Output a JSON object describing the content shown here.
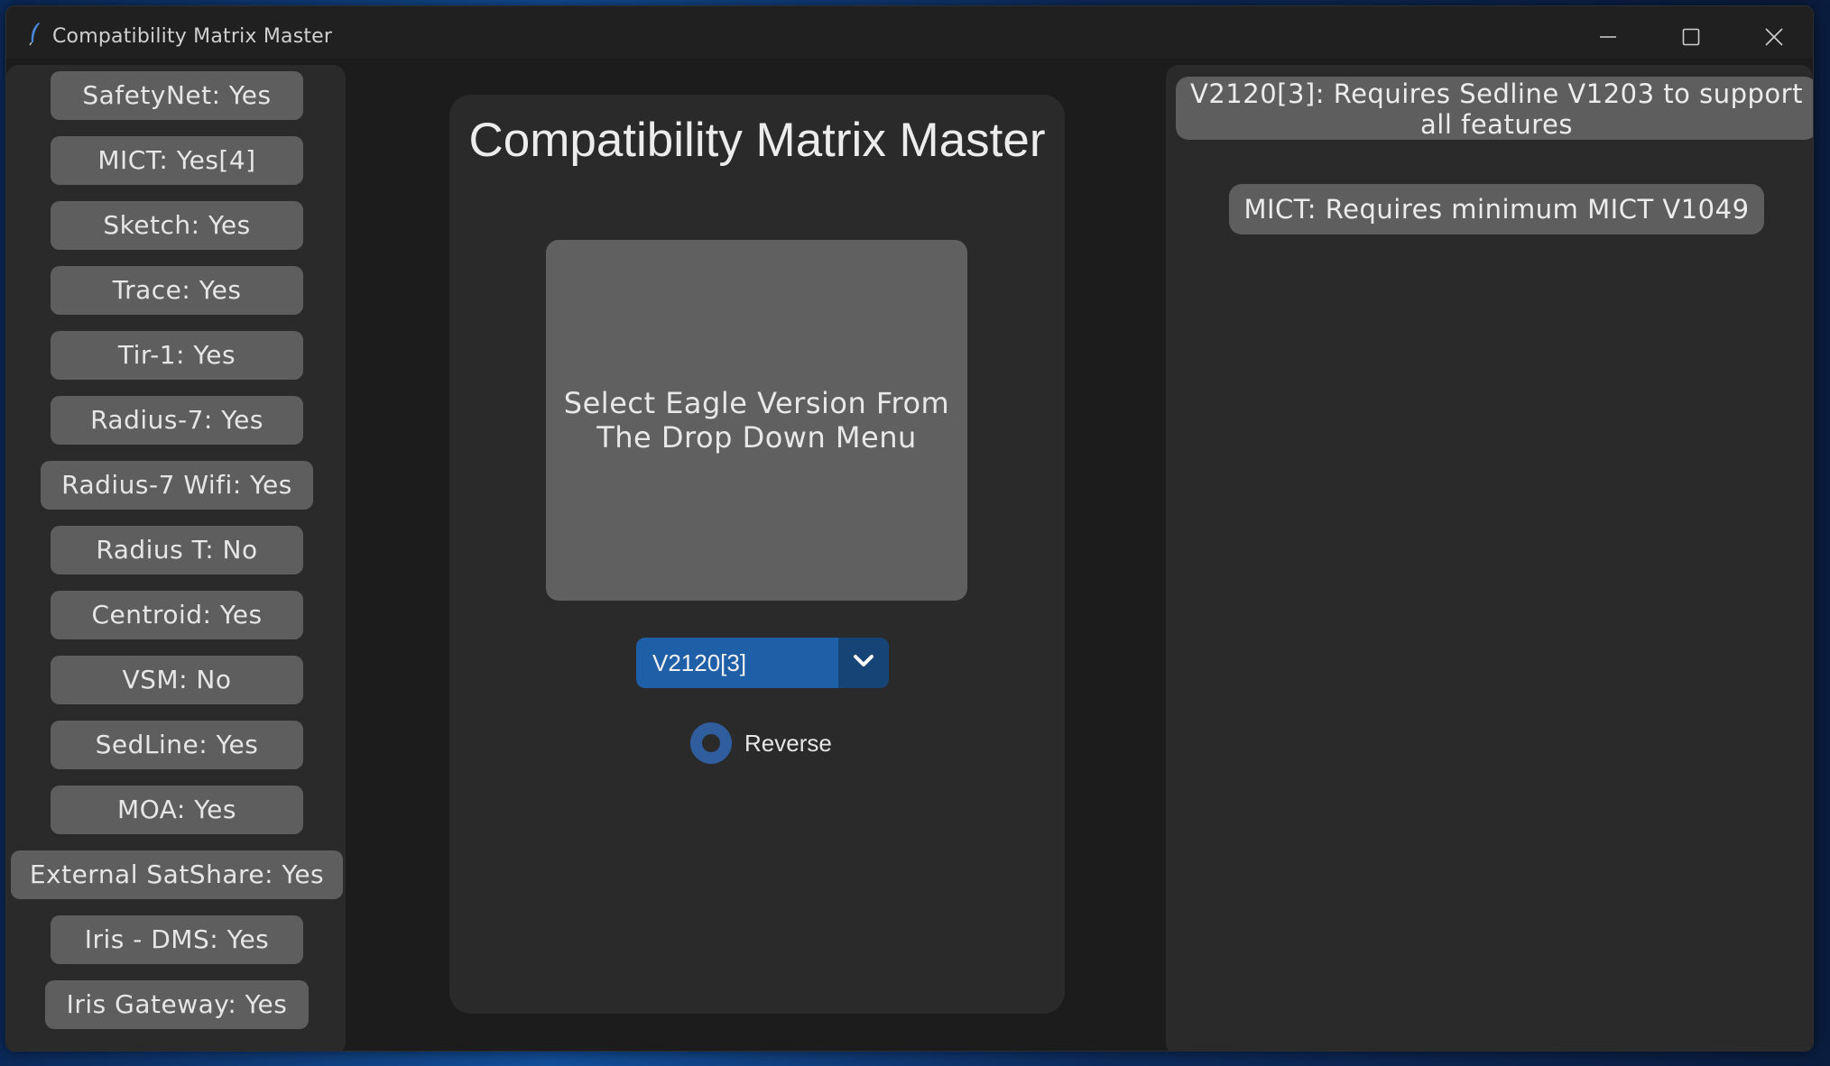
{
  "window": {
    "title": "Compatibility Matrix Master"
  },
  "features": [
    {
      "label": "SafetyNet: Yes"
    },
    {
      "label": "MICT: Yes[4]"
    },
    {
      "label": "Sketch: Yes"
    },
    {
      "label": "Trace: Yes"
    },
    {
      "label": "Tir-1: Yes"
    },
    {
      "label": "Radius-7: Yes"
    },
    {
      "label": "Radius-7 Wifi: Yes"
    },
    {
      "label": "Radius T: No"
    },
    {
      "label": "Centroid: Yes"
    },
    {
      "label": "VSM: No"
    },
    {
      "label": "SedLine: Yes"
    },
    {
      "label": "MOA: Yes"
    },
    {
      "label": "External SatShare: Yes"
    },
    {
      "label": "Iris - DMS: Yes"
    },
    {
      "label": "Iris Gateway: Yes"
    }
  ],
  "main": {
    "heading": "Compatibility Matrix Master",
    "preview_text": "Select Eagle Version From The Drop Down Menu",
    "version_dropdown": {
      "value": "V2120[3]"
    },
    "reverse_label": "Reverse"
  },
  "notes": [
    {
      "text": "V2120[3]: Requires Sedline V1203 to support all features"
    },
    {
      "text": "MICT: Requires minimum MICT V1049"
    }
  ],
  "colors": {
    "panel_bg": "#2a2a2a",
    "button_bg": "#5e5e5e",
    "accent_blue": "#1f5fa8",
    "accent_blue_dark": "#164476"
  },
  "icons": {
    "app": "feather-icon",
    "minimize": "minimize-icon",
    "maximize": "maximize-icon",
    "close": "close-icon",
    "dropdown": "chevron-down-icon"
  }
}
